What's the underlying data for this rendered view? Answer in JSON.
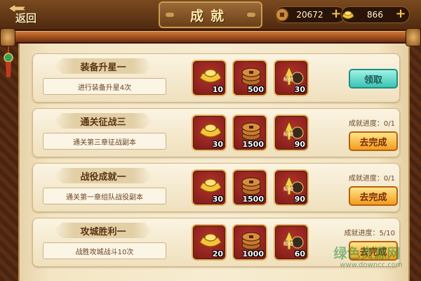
{
  "header": {
    "back_label": "返回",
    "title": "成就",
    "coins": "20672",
    "gold": "866"
  },
  "achievements": [
    {
      "title": "装备升星一",
      "description": "进行装备升星4次",
      "rewards": [
        "10",
        "500",
        "30"
      ],
      "progress_label": "",
      "action_label": "领取",
      "action_type": "claim"
    },
    {
      "title": "通关征战三",
      "description": "通关第三章征战副本",
      "rewards": [
        "30",
        "1500",
        "90"
      ],
      "progress_label": "成就进度：0/1",
      "action_label": "去完成",
      "action_type": "go"
    },
    {
      "title": "战役成就一",
      "description": "通关第一章组队战役副本",
      "rewards": [
        "30",
        "1500",
        "90"
      ],
      "progress_label": "成就进度：0/1",
      "action_label": "去完成",
      "action_type": "go"
    },
    {
      "title": "攻城胜利一",
      "description": "战胜攻城战斗10次",
      "rewards": [
        "20",
        "1000",
        "60"
      ],
      "progress_label": "成就进度：5/10",
      "action_label": "去完成",
      "action_type": "go"
    }
  ],
  "watermark": {
    "text": "绿色资源网",
    "url": "www.downcc.com"
  },
  "colors": {
    "claim_button": "#3cc4b4",
    "go_button": "#f29c1f",
    "reward_frame": "#7a1b18"
  }
}
